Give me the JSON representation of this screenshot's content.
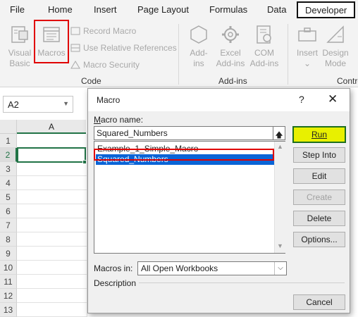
{
  "tabs": [
    "File",
    "Home",
    "Insert",
    "Page Layout",
    "Formulas",
    "Data",
    "Developer"
  ],
  "ribbon": {
    "code": {
      "visual_basic": [
        "Visual",
        "Basic"
      ],
      "macros": "Macros",
      "record_macro": "Record Macro",
      "relative_refs": "Use Relative References",
      "macro_security": "Macro Security",
      "group": "Code"
    },
    "addins": {
      "addins": [
        "Add-",
        "ins"
      ],
      "excel_addins": [
        "Excel",
        "Add-ins"
      ],
      "com_addins": [
        "COM",
        "Add-ins"
      ],
      "group": "Add-ins"
    },
    "controls": {
      "insert": "Insert",
      "design_mode": [
        "Design",
        "Mode"
      ],
      "group": "Contro"
    }
  },
  "formula_bar": {
    "name_box": "A2"
  },
  "grid": {
    "column": "A",
    "rows": [
      "1",
      "2",
      "3",
      "4",
      "5",
      "6",
      "7",
      "8",
      "9",
      "10",
      "11",
      "12",
      "13"
    ],
    "active_cell": "A2"
  },
  "dialog": {
    "title": "Macro",
    "help": "?",
    "close": "✕",
    "macro_name_label": "Macro name:",
    "macro_name_value": "Squared_Numbers",
    "macros": [
      "Example_1_Simple_Macro",
      "Squared_Numbers"
    ],
    "selected_index": 1,
    "buttons": {
      "run": "Run",
      "step_into": "Step Into",
      "edit": "Edit",
      "create": "Create",
      "delete": "Delete",
      "options": "Options...",
      "cancel": "Cancel"
    },
    "macros_in_label": "Macros in:",
    "macros_in_value": "All Open Workbooks",
    "description_label": "Description"
  },
  "colors": {
    "highlight_red": "#e00000",
    "run_yellow": "#e8f000",
    "excel_green": "#217346",
    "selection_blue": "#0a64d6"
  }
}
